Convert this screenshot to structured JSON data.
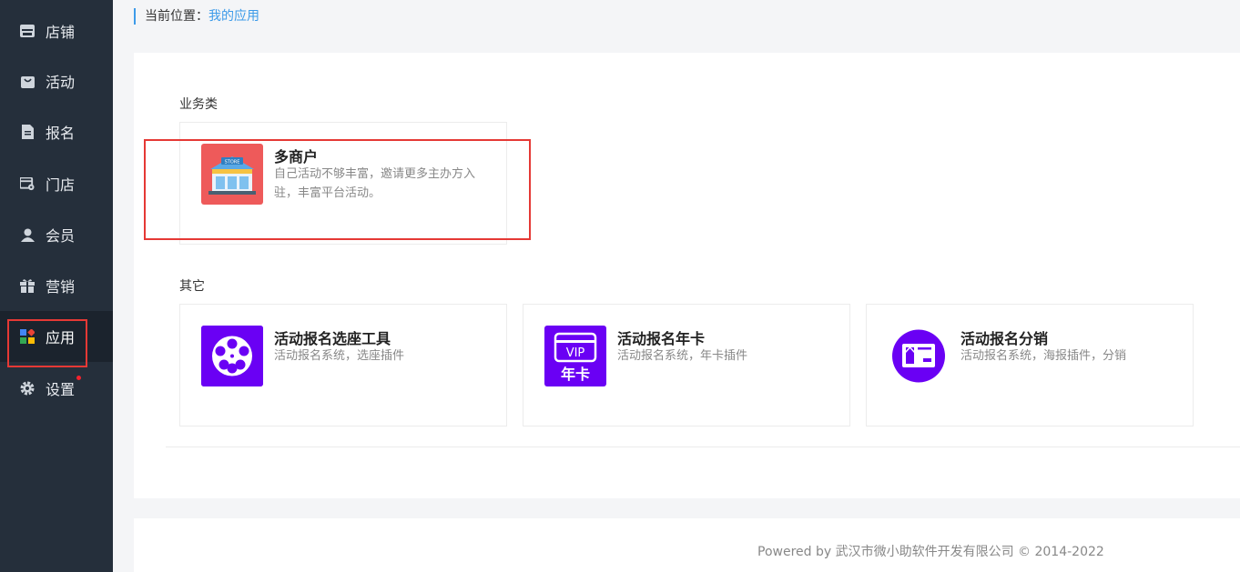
{
  "sidebar": {
    "items": [
      {
        "label": "店铺",
        "icon": "store-icon"
      },
      {
        "label": "活动",
        "icon": "bag-icon"
      },
      {
        "label": "报名",
        "icon": "document-icon"
      },
      {
        "label": "门店",
        "icon": "shop-settings-icon"
      },
      {
        "label": "会员",
        "icon": "user-icon"
      },
      {
        "label": "营销",
        "icon": "gift-icon"
      },
      {
        "label": "应用",
        "icon": "apps-icon",
        "active": true
      },
      {
        "label": "设置",
        "icon": "gear-icon",
        "badge_dot": true
      }
    ]
  },
  "breadcrumb": {
    "prefix": "当前位置：",
    "current": "我的应用"
  },
  "sections": {
    "business": {
      "title": "业务类",
      "cards": [
        {
          "title": "多商户",
          "desc": "自己活动不够丰富，邀请更多主办方入驻，丰富平台活动。",
          "icon": "store-front-icon",
          "icon_text": "STORE",
          "icon_bg": "#ee5a5a"
        }
      ]
    },
    "other": {
      "title": "其它",
      "cards": [
        {
          "title": "活动报名选座工具",
          "desc": "活动报名系统，选座插件",
          "icon": "film-reel-icon",
          "icon_bg": "#6a00f4"
        },
        {
          "title": "活动报名年卡",
          "desc": "活动报名系统，年卡插件",
          "icon": "vip-card-icon",
          "icon_text_top": "VIP",
          "icon_text_bottom": "年卡",
          "icon_bg": "#6a00f4"
        },
        {
          "title": "活动报名分销",
          "desc": "活动报名系统，海报插件，分销",
          "icon": "gift-card-icon",
          "icon_bg": "#6a00f4"
        }
      ]
    }
  },
  "footer": {
    "text": "Powered by 武汉市微小助软件开发有限公司 © 2014-2022"
  },
  "colors": {
    "sidebar_bg": "#252f3b",
    "accent_blue": "#3d9be9",
    "highlight_red": "#e53935",
    "purple": "#6a00f4"
  }
}
